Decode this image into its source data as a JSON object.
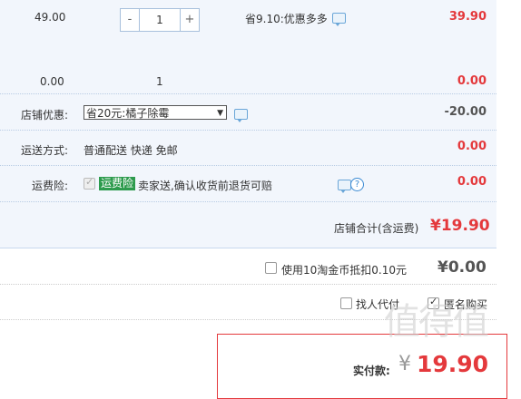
{
  "item1": {
    "price": "49.00",
    "qty": "1",
    "minus": "-",
    "plus": "+",
    "promo": "省9.10:优惠多多",
    "total": "39.90"
  },
  "item2": {
    "price": "0.00",
    "qty": "1",
    "total": "0.00"
  },
  "shop_discount": {
    "label": "店铺优惠:",
    "selected": "省20元:橘子除霉",
    "amount": "-20.00"
  },
  "shipping": {
    "label": "运送方式:",
    "method": "普通配送 快递 免邮",
    "amount": "0.00"
  },
  "insurance": {
    "label": "运费险:",
    "tag": "运费险",
    "desc": "卖家送,确认收货前退货可赔",
    "amount": "0.00"
  },
  "shop_total": {
    "label": "店铺合计(含运费)",
    "amount": "¥19.90"
  },
  "coins": {
    "label": "使用10淘金币抵扣0.10元",
    "amount": "¥0.00"
  },
  "options": {
    "proxy_pay": "找人代付",
    "anonymous": "匿名购买"
  },
  "payment": {
    "label": "实付款:",
    "currency": "¥",
    "amount": "19.90"
  },
  "watermark": "值得值",
  "colors": {
    "accent": "#e4393c",
    "panel": "#f2f6fc",
    "tag_green": "#2d9b4d"
  }
}
